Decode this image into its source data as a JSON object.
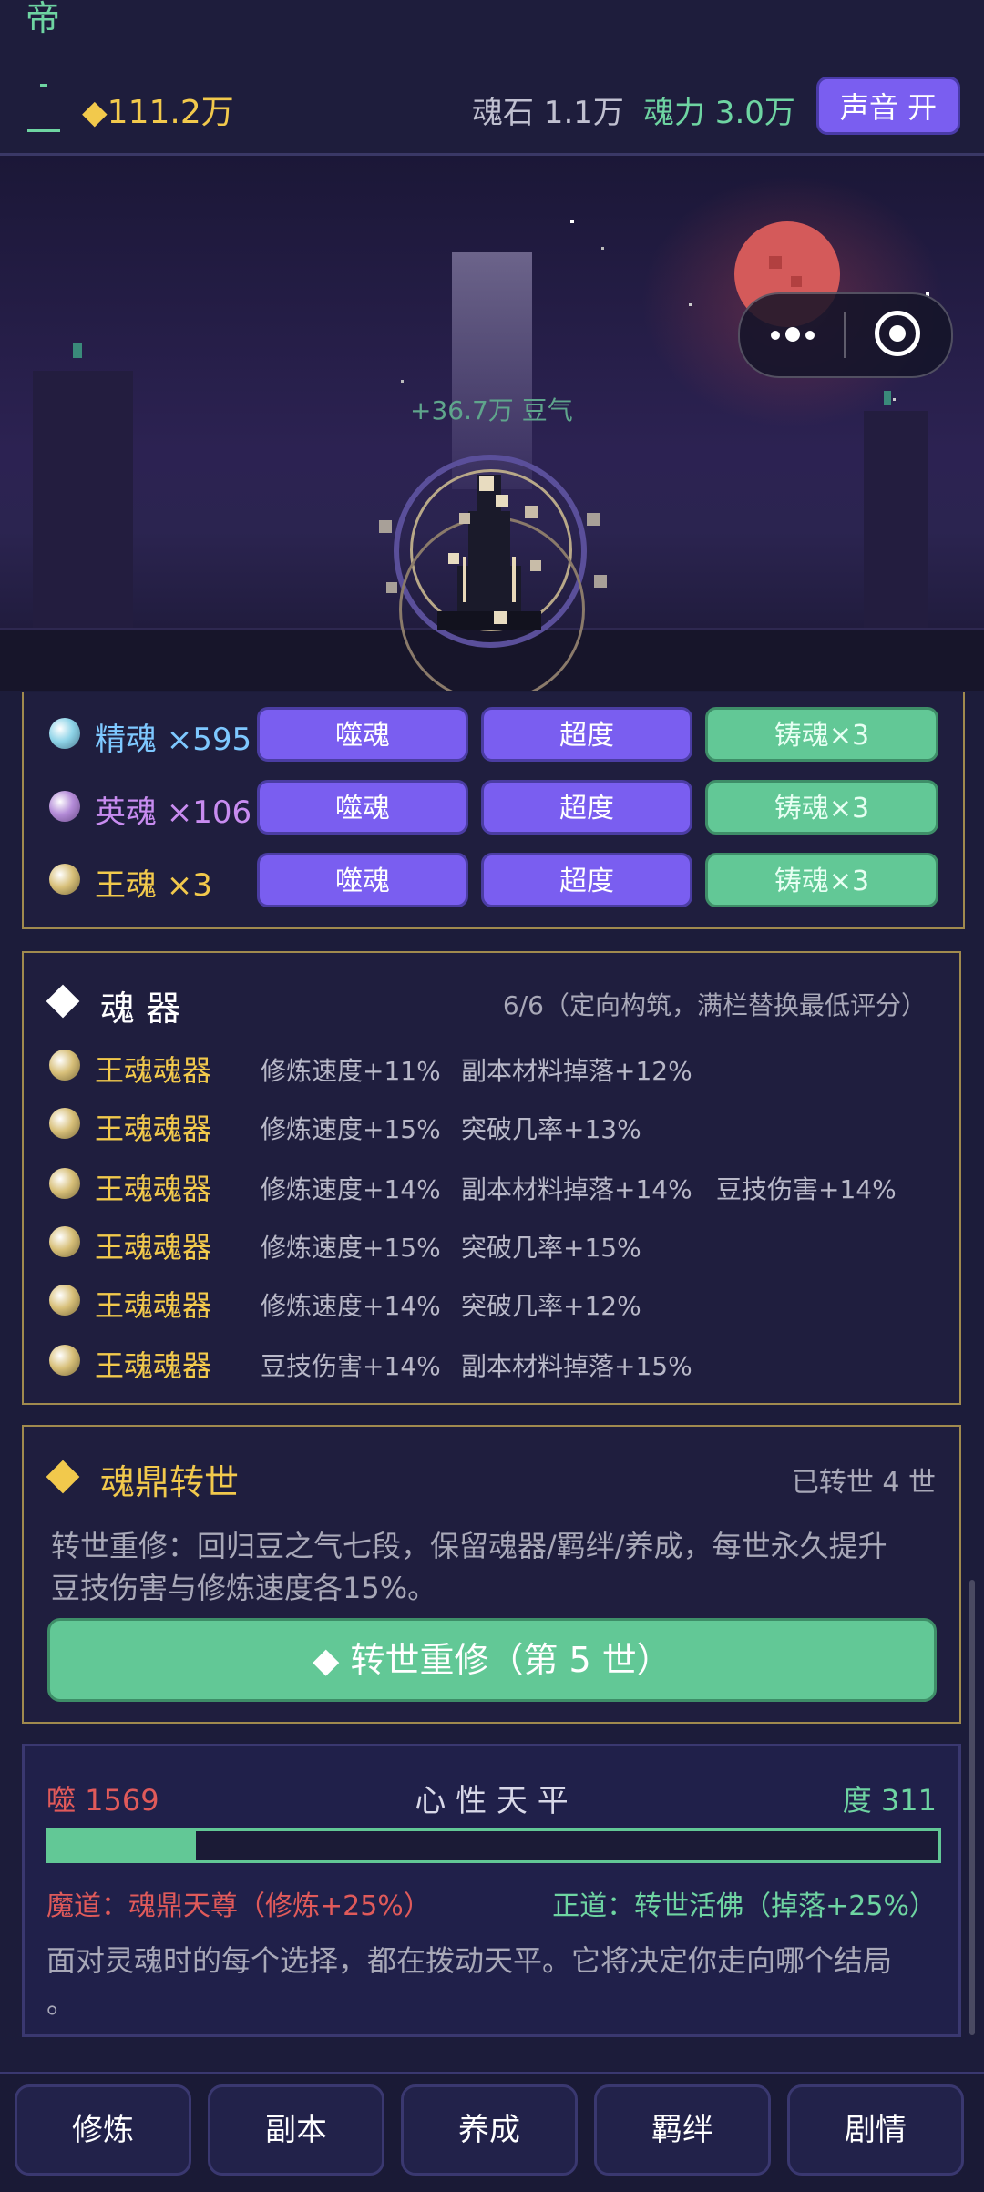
{
  "header": {
    "realm_title": "帝",
    "gold": "◆111.2万",
    "soul_stone": "魂石 1.1万",
    "soul_power": "魂力 3.0万",
    "sound_button": "声音 开"
  },
  "scene": {
    "floating_text": "+36.7万 豆气"
  },
  "souls": [
    {
      "name": "精魂 ×595",
      "color": "#7ec8ff",
      "orb_color": "#8fd4e8",
      "devour": "噬魂",
      "release": "超度",
      "forge": "铸魂×3"
    },
    {
      "name": "英魂 ×106",
      "color": "#c88cf0",
      "orb_color": "#b48cd8",
      "devour": "噬魂",
      "release": "超度",
      "forge": "铸魂×3"
    },
    {
      "name": "王魂 ×3",
      "color": "#f2c94c",
      "orb_color": "#d8c07a",
      "devour": "噬魂",
      "release": "超度",
      "forge": "铸魂×3"
    }
  ],
  "artifacts": {
    "title": "魂 器",
    "summary": "6/6（定向构筑，满栏替换最低评分）",
    "items": [
      {
        "name": "王魂魂器",
        "attrs": [
          "修炼速度+11%",
          "副本材料掉落+12%"
        ]
      },
      {
        "name": "王魂魂器",
        "attrs": [
          "修炼速度+15%",
          "突破几率+13%"
        ]
      },
      {
        "name": "王魂魂器",
        "attrs": [
          "修炼速度+14%",
          "副本材料掉落+14%",
          "豆技伤害+14%"
        ]
      },
      {
        "name": "王魂魂器",
        "attrs": [
          "修炼速度+15%",
          "突破几率+15%"
        ]
      },
      {
        "name": "王魂魂器",
        "attrs": [
          "修炼速度+14%",
          "突破几率+12%"
        ]
      },
      {
        "name": "王魂魂器",
        "attrs": [
          "豆技伤害+14%",
          "副本材料掉落+15%"
        ]
      }
    ]
  },
  "rebirth": {
    "title": "魂鼎转世",
    "count": "已转世 4 世",
    "desc_line1": "转世重修：回归豆之气七段，保留魂器/羁绊/养成，每世永久提升",
    "desc_line2": "豆技伤害与修炼速度各15%。",
    "button": "◆ 转世重修（第 5 世）"
  },
  "balance": {
    "left": "噬 1569",
    "title": "心 性 天 平",
    "right": "度 311",
    "fill_fraction": 0.165,
    "evil_path": "魔道：魂鼎天尊（修炼+25%）",
    "good_path": "正道：转世活佛（掉落+25%）",
    "note_line1": "面对灵魂时的每个选择，都在拨动天平。它将决定你走向哪个结局",
    "note_line2": "。"
  },
  "nav": [
    "修炼",
    "副本",
    "养成",
    "羁绊",
    "剧情"
  ]
}
